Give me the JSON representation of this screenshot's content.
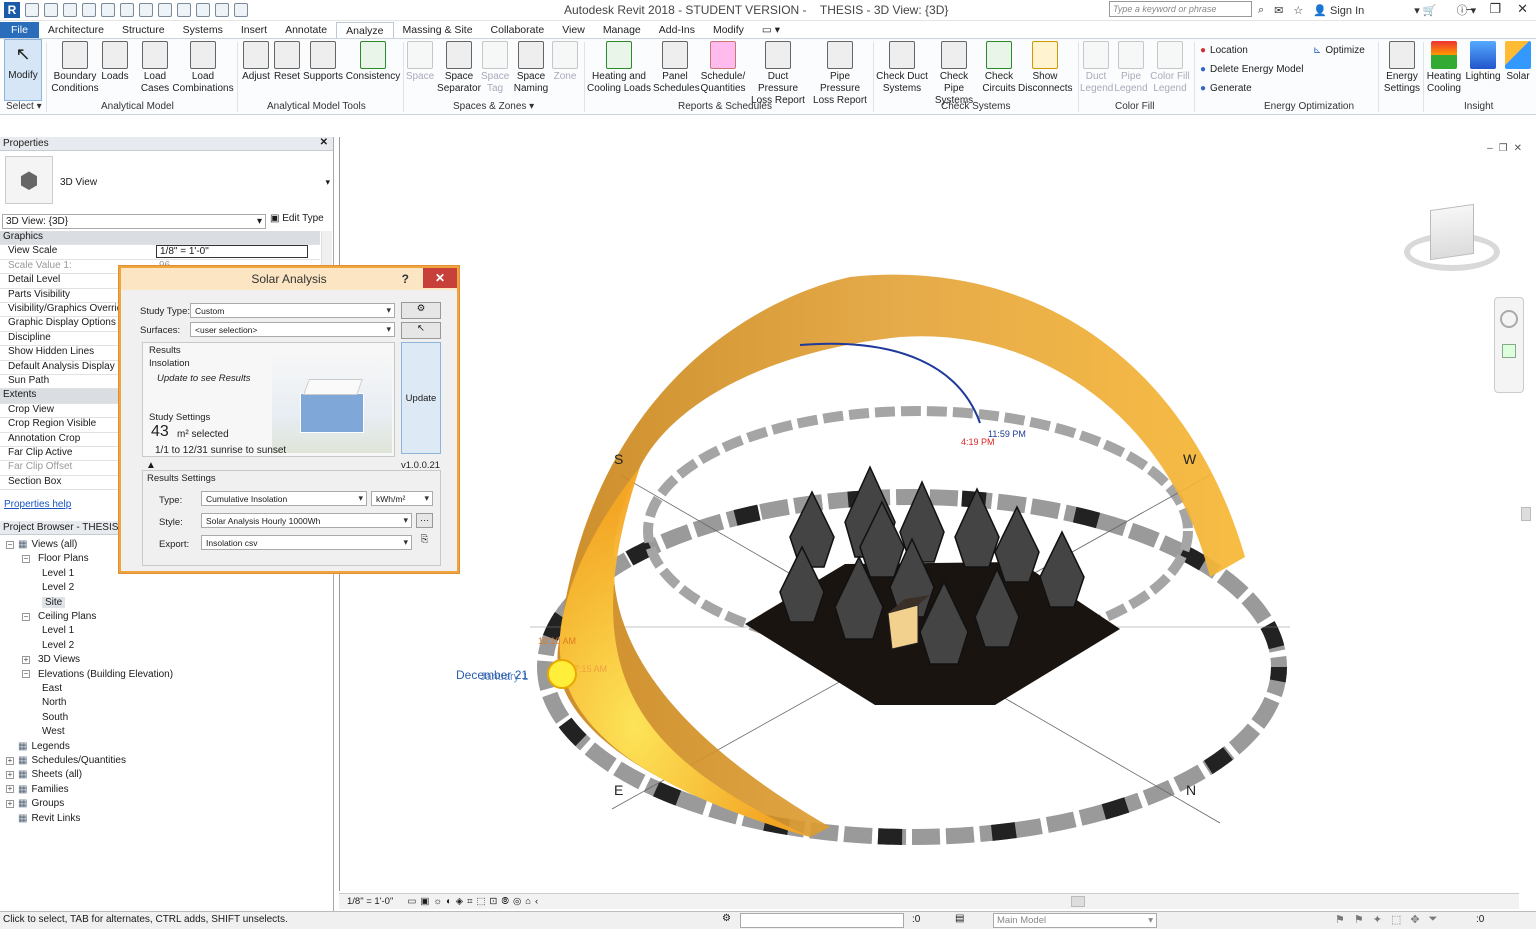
{
  "window": {
    "title": "Autodesk Revit 2018 - STUDENT VERSION -",
    "subtitle": "THESIS - 3D View: {3D}",
    "search_placeholder": "Type a keyword or phrase",
    "sign_in": "Sign In"
  },
  "tabs": [
    "File",
    "Architecture",
    "Structure",
    "Systems",
    "Insert",
    "Annotate",
    "Analyze",
    "Massing & Site",
    "Collaborate",
    "View",
    "Manage",
    "Add-Ins",
    "Modify"
  ],
  "ribbon": {
    "modify": "Modify",
    "select": "Select",
    "boundary": "Boundary Conditions",
    "loads": "Loads",
    "load_cases": "Load Cases",
    "load_comb": "Load Combinations",
    "panel_analytical": "Analytical Model",
    "adjust": "Adjust",
    "reset": "Reset",
    "supports": "Supports",
    "consistency": "Consistency",
    "panel_tools": "Analytical Model Tools",
    "space": "Space",
    "space_sep": "Space Separator",
    "space_tag": "Space Tag",
    "space_naming": "Space Naming",
    "zone": "Zone",
    "panel_spaces": "Spaces & Zones",
    "heating_cooling": "Heating and Cooling Loads",
    "panel_schedules": "Panel Schedules",
    "schedule_qty": "Schedule/ Quantities",
    "duct_pressure": "Duct Pressure Loss Report",
    "pipe_pressure": "Pipe Pressure Loss Report",
    "panel_reports": "Reports & Schedules",
    "check_duct": "Check Duct Systems",
    "check_pipe": "Check Pipe Systems",
    "check_circuits": "Check Circuits",
    "show_disconnects": "Show Disconnects",
    "panel_check": "Check Systems",
    "duct_legend": "Duct Legend",
    "pipe_legend": "Pipe Legend",
    "color_fill_legend": "Color Fill Legend",
    "panel_color": "Color Fill",
    "location": "Location",
    "delete_energy": "Delete Energy Model",
    "generate": "Generate",
    "optimize": "Optimize",
    "panel_energy": "Energy Optimization",
    "energy_settings": "Energy Settings",
    "heating_cooling2": "Heating Cooling",
    "lighting": "Lighting",
    "solar": "Solar",
    "panel_insight": "Insight"
  },
  "properties": {
    "header": "Properties",
    "type_name": "3D View",
    "instance": "3D View: {3D}",
    "edit_type": "Edit Type",
    "help": "Properties help",
    "rows": [
      {
        "label": "Graphics",
        "kind": "grp"
      },
      {
        "label": "View Scale",
        "value": "1/8\" = 1'-0\""
      },
      {
        "label": "Scale Value    1:",
        "value": "96",
        "kind": "dim"
      },
      {
        "label": "Detail Level"
      },
      {
        "label": "Parts Visibility"
      },
      {
        "label": "Visibility/Graphics Overrides"
      },
      {
        "label": "Graphic Display Options"
      },
      {
        "label": "Discipline"
      },
      {
        "label": "Show Hidden Lines"
      },
      {
        "label": "Default Analysis Display Style"
      },
      {
        "label": "Sun Path"
      },
      {
        "label": "Extents",
        "kind": "grp"
      },
      {
        "label": "Crop View"
      },
      {
        "label": "Crop Region Visible"
      },
      {
        "label": "Annotation Crop"
      },
      {
        "label": "Far Clip Active"
      },
      {
        "label": "Far Clip Offset",
        "kind": "dim"
      },
      {
        "label": "Section Box"
      }
    ]
  },
  "browser": {
    "header": "Project Browser - THESIS",
    "items": [
      {
        "label": "Views (all)",
        "level": 0,
        "exp": "−"
      },
      {
        "label": "Floor Plans",
        "level": 1,
        "exp": "−"
      },
      {
        "label": "Level 1",
        "level": 2
      },
      {
        "label": "Level 2",
        "level": 2
      },
      {
        "label": "Site",
        "level": 2,
        "sel": true
      },
      {
        "label": "Ceiling Plans",
        "level": 1,
        "exp": "−"
      },
      {
        "label": "Level 1",
        "level": 2
      },
      {
        "label": "Level 2",
        "level": 2
      },
      {
        "label": "3D Views",
        "level": 1,
        "exp": "+"
      },
      {
        "label": "Elevations (Building Elevation)",
        "level": 1,
        "exp": "−"
      },
      {
        "label": "East",
        "level": 2
      },
      {
        "label": "North",
        "level": 2
      },
      {
        "label": "South",
        "level": 2
      },
      {
        "label": "West",
        "level": 2
      },
      {
        "label": "Legends",
        "level": 0,
        "exp": ""
      },
      {
        "label": "Schedules/Quantities",
        "level": 0,
        "exp": "+"
      },
      {
        "label": "Sheets (all)",
        "level": 0,
        "exp": "+"
      },
      {
        "label": "Families",
        "level": 0,
        "exp": "+"
      },
      {
        "label": "Groups",
        "level": 0,
        "exp": "+"
      },
      {
        "label": "Revit Links",
        "level": 0,
        "exp": ""
      }
    ]
  },
  "dialog": {
    "title": "Solar Analysis",
    "help": "?",
    "close": "✕",
    "study_type_label": "Study Type:",
    "study_type": "Custom",
    "surfaces_label": "Surfaces:",
    "surfaces": "<user selection>",
    "results": "Results",
    "insolation": "Insolation",
    "update_hint": "Update to see Results",
    "study_settings": "Study Settings",
    "area_num": "43",
    "area_text": "m² selected",
    "range": "1/1 to 12/31 sunrise to sunset",
    "update": "Update",
    "version": "v1.0.0.21",
    "results_settings": "Results Settings",
    "type_label": "Type:",
    "type": "Cumulative Insolation",
    "unit": "kWh/m²",
    "style_label": "Style:",
    "style": "Solar Analysis Hourly 1000Wh",
    "export_label": "Export:",
    "export": "Insolation csv"
  },
  "scene": {
    "S": "S",
    "W": "W",
    "E": "E",
    "N": "N",
    "time_1159": "11:59 PM",
    "time_419": "4:19 PM",
    "time_am1": "10:10 AM",
    "time_am2": "7:15 AM",
    "date": "December 21",
    "date2": "January 1"
  },
  "viewctl": {
    "scale": "1/8\" = 1'-0\""
  },
  "status": {
    "msg": "Click to select, TAB for alternates, CTRL adds, SHIFT unselects.",
    "zero": ":0",
    "model": "Main Model",
    "filter": ":0"
  },
  "colors": {
    "accent": "#2a6ebb",
    "sunpath": "#f5a623",
    "close": "#c7403a"
  }
}
